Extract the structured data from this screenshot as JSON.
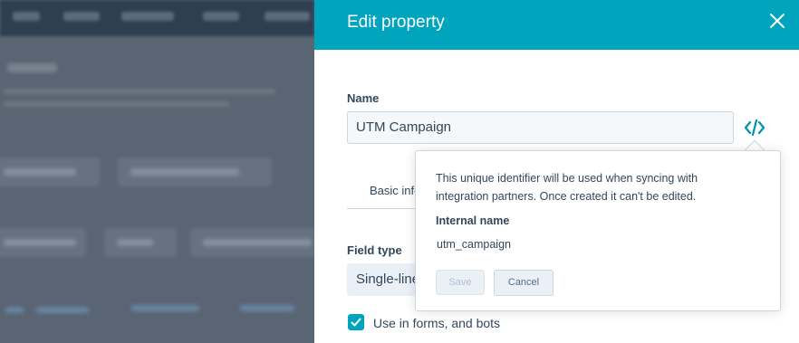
{
  "panel": {
    "title": "Edit property",
    "name_label": "Name",
    "name_value": "UTM Campaign",
    "tab_label": "Basic info",
    "field_type_label": "Field type",
    "field_type_value": "Single-line text",
    "checkbox_label": "Use in forms, and bots",
    "checkbox_checked": true
  },
  "popover": {
    "description": "This unique identifier will be used when syncing with integration partners. Once created it can't be edited.",
    "internal_name_label": "Internal name",
    "internal_name_value": "utm_campaign",
    "save_label": "Save",
    "cancel_label": "Cancel"
  },
  "icons": {
    "close": "close-icon",
    "code": "code-icon",
    "check": "check-icon"
  },
  "colors": {
    "header": "#00a4bd",
    "text": "#33475b",
    "accent": "#0091ae"
  }
}
